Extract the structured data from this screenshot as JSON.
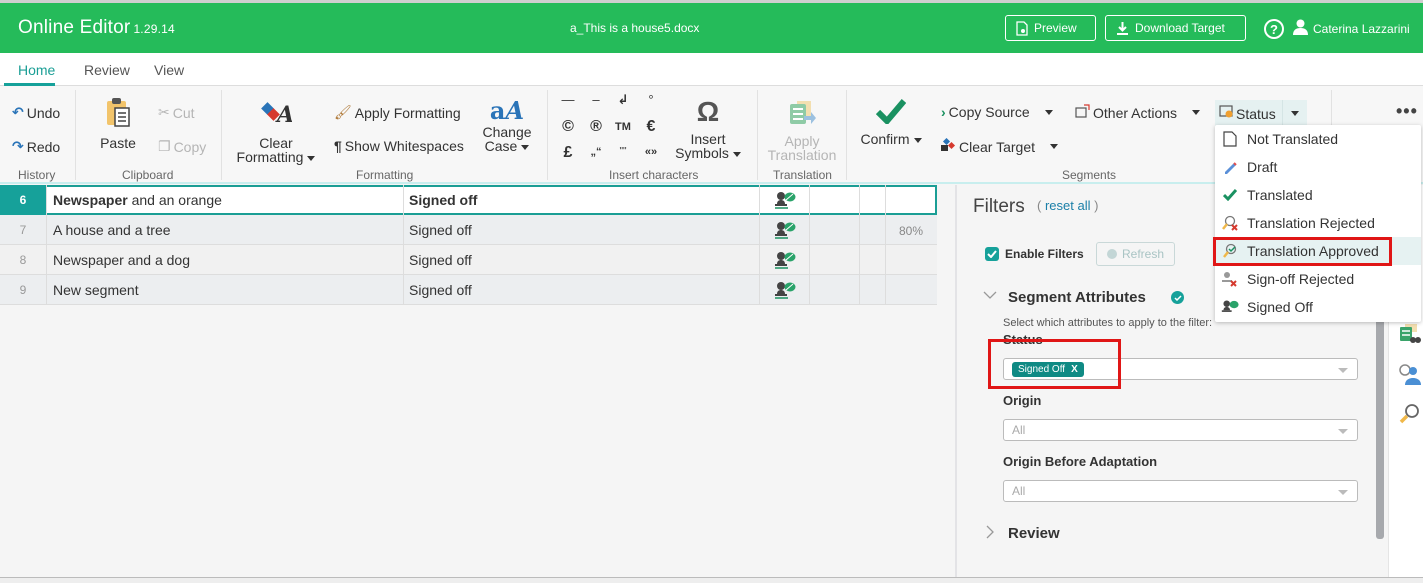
{
  "header": {
    "app_title": "Online Editor",
    "version": "1.29.14",
    "document_name": "a_This is a house5.docx",
    "preview_label": "Preview",
    "download_label": "Download Target",
    "help_label": "?",
    "user_name": "Caterina Lazzarini",
    "brand_color": "#25bb5a"
  },
  "tabs": [
    {
      "label": "Home",
      "active": true
    },
    {
      "label": "Review",
      "active": false
    },
    {
      "label": "View",
      "active": false
    }
  ],
  "ribbon": {
    "history": {
      "label": "History",
      "undo": "Undo",
      "redo": "Redo"
    },
    "clipboard": {
      "label": "Clipboard",
      "paste": "Paste",
      "cut": "Cut",
      "copy": "Copy"
    },
    "formatting": {
      "label": "Formatting",
      "clear_line1": "Clear",
      "clear_line2": "Formatting",
      "apply": "Apply Formatting",
      "whitespace": "Show Whitespaces",
      "case_line1": "Change",
      "case_line2": "Case"
    },
    "insert_chars": {
      "label": "Insert characters",
      "symbols": [
        "—",
        "–",
        "↲",
        "°",
        "©",
        "®",
        "TM",
        "€",
        "£",
        "„“",
        "\"\"",
        "«»"
      ],
      "insert_line1": "Insert",
      "insert_line2": "Symbols"
    },
    "translation": {
      "label": "Translation",
      "apply_line1": "Apply",
      "apply_line2": "Translation"
    },
    "segments": {
      "label": "Segments",
      "confirm": "Confirm",
      "copy_source": "Copy Source",
      "clear_target": "Clear Target",
      "other_actions": "Other Actions",
      "status": "Status"
    },
    "more": "•••"
  },
  "status_menu": {
    "items": [
      {
        "label": "Not Translated",
        "icon": "document-icon",
        "highlighted": false
      },
      {
        "label": "Draft",
        "icon": "pencil-icon",
        "highlighted": false
      },
      {
        "label": "Translated",
        "icon": "checkmark-icon",
        "highlighted": false
      },
      {
        "label": "Translation Rejected",
        "icon": "magnifier-reject-icon",
        "highlighted": false
      },
      {
        "label": "Translation Approved",
        "icon": "magnifier-approve-icon",
        "highlighted": true
      },
      {
        "label": "Sign-off Rejected",
        "icon": "stamp-reject-icon",
        "highlighted": false
      },
      {
        "label": "Signed Off",
        "icon": "stamp-signed-icon",
        "highlighted": false
      }
    ]
  },
  "segments": [
    {
      "num": "6",
      "source_bold": "Newspaper",
      "source_rest": " and an orange",
      "target": "Signed off",
      "status_icon": "signed-off-icon",
      "match": "",
      "active": true
    },
    {
      "num": "7",
      "source_bold": "",
      "source_rest": "A house and a tree",
      "target": "Signed off",
      "status_icon": "signed-off-icon",
      "match": "80%",
      "active": false
    },
    {
      "num": "8",
      "source_bold": "",
      "source_rest": "Newspaper and a dog",
      "target": "Signed off",
      "status_icon": "signed-off-icon",
      "match": "",
      "active": false
    },
    {
      "num": "9",
      "source_bold": "",
      "source_rest": "New segment",
      "target": "Signed off",
      "status_icon": "signed-off-icon",
      "match": "",
      "active": false
    }
  ],
  "filters": {
    "title": "Filters",
    "reset_open": "(",
    "reset_label": "reset all",
    "reset_close": ")",
    "enable_label": "Enable Filters",
    "enabled": true,
    "refresh_label": "Refresh",
    "segment_attributes": "Segment Attributes",
    "instructions": "Select which attributes to apply to the filter:",
    "status_label": "Status",
    "status_tag": "Signed Off",
    "tag_remove": "X",
    "origin_label": "Origin",
    "origin_value": "All",
    "origin_before_label": "Origin Before Adaptation",
    "origin_before_value": "All",
    "review_label": "Review"
  }
}
